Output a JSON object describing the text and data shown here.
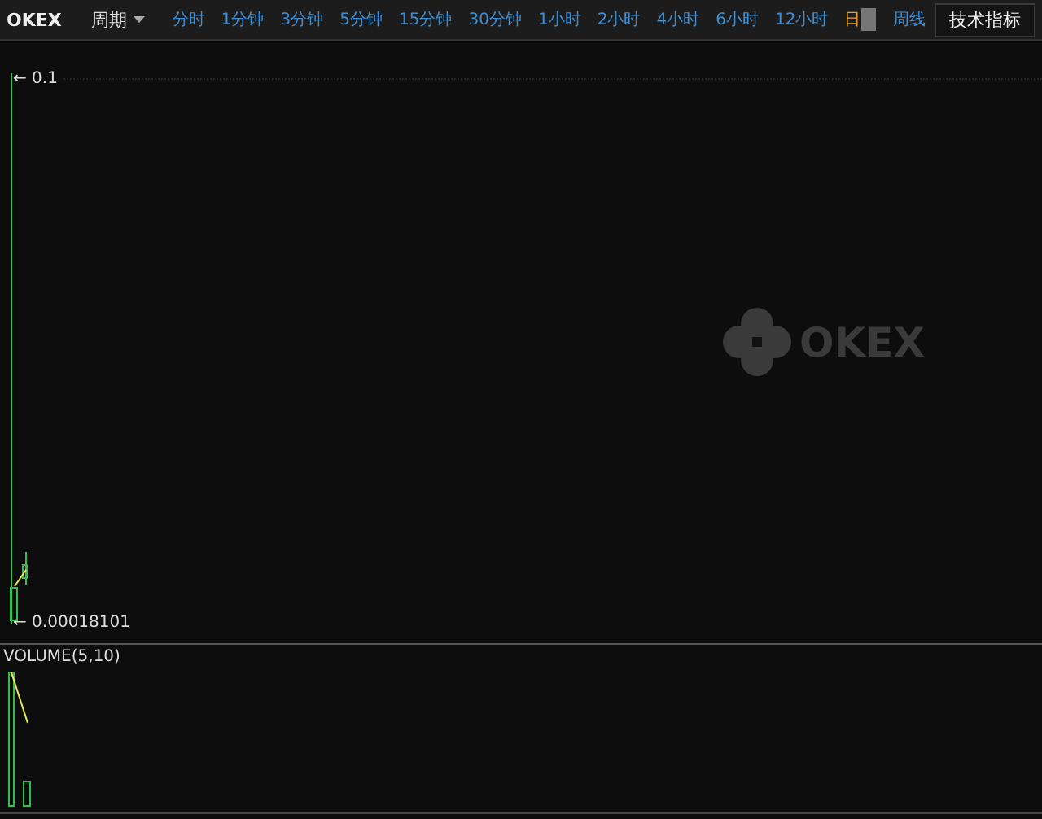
{
  "toolbar": {
    "brand": "OKEX",
    "period_menu": "周期",
    "periods": [
      {
        "label": "分时",
        "selected": false
      },
      {
        "label": "1分钟",
        "selected": false
      },
      {
        "label": "3分钟",
        "selected": false
      },
      {
        "label": "5分钟",
        "selected": false
      },
      {
        "label": "15分钟",
        "selected": false
      },
      {
        "label": "30分钟",
        "selected": false
      },
      {
        "label": "1小时",
        "selected": false
      },
      {
        "label": "2小时",
        "selected": false
      },
      {
        "label": "4小时",
        "selected": false
      },
      {
        "label": "6小时",
        "selected": false
      },
      {
        "label": "12小时",
        "selected": false
      },
      {
        "label": "日",
        "selected": true
      },
      {
        "label": "周线",
        "selected": false
      }
    ],
    "indicators_button": "技术指标"
  },
  "price_chart": {
    "high_label": "← 0.1",
    "low_label": "← 0.00018101",
    "logo_text": "OKEX"
  },
  "volume_chart": {
    "title": "VOLUME(5,10)"
  }
}
